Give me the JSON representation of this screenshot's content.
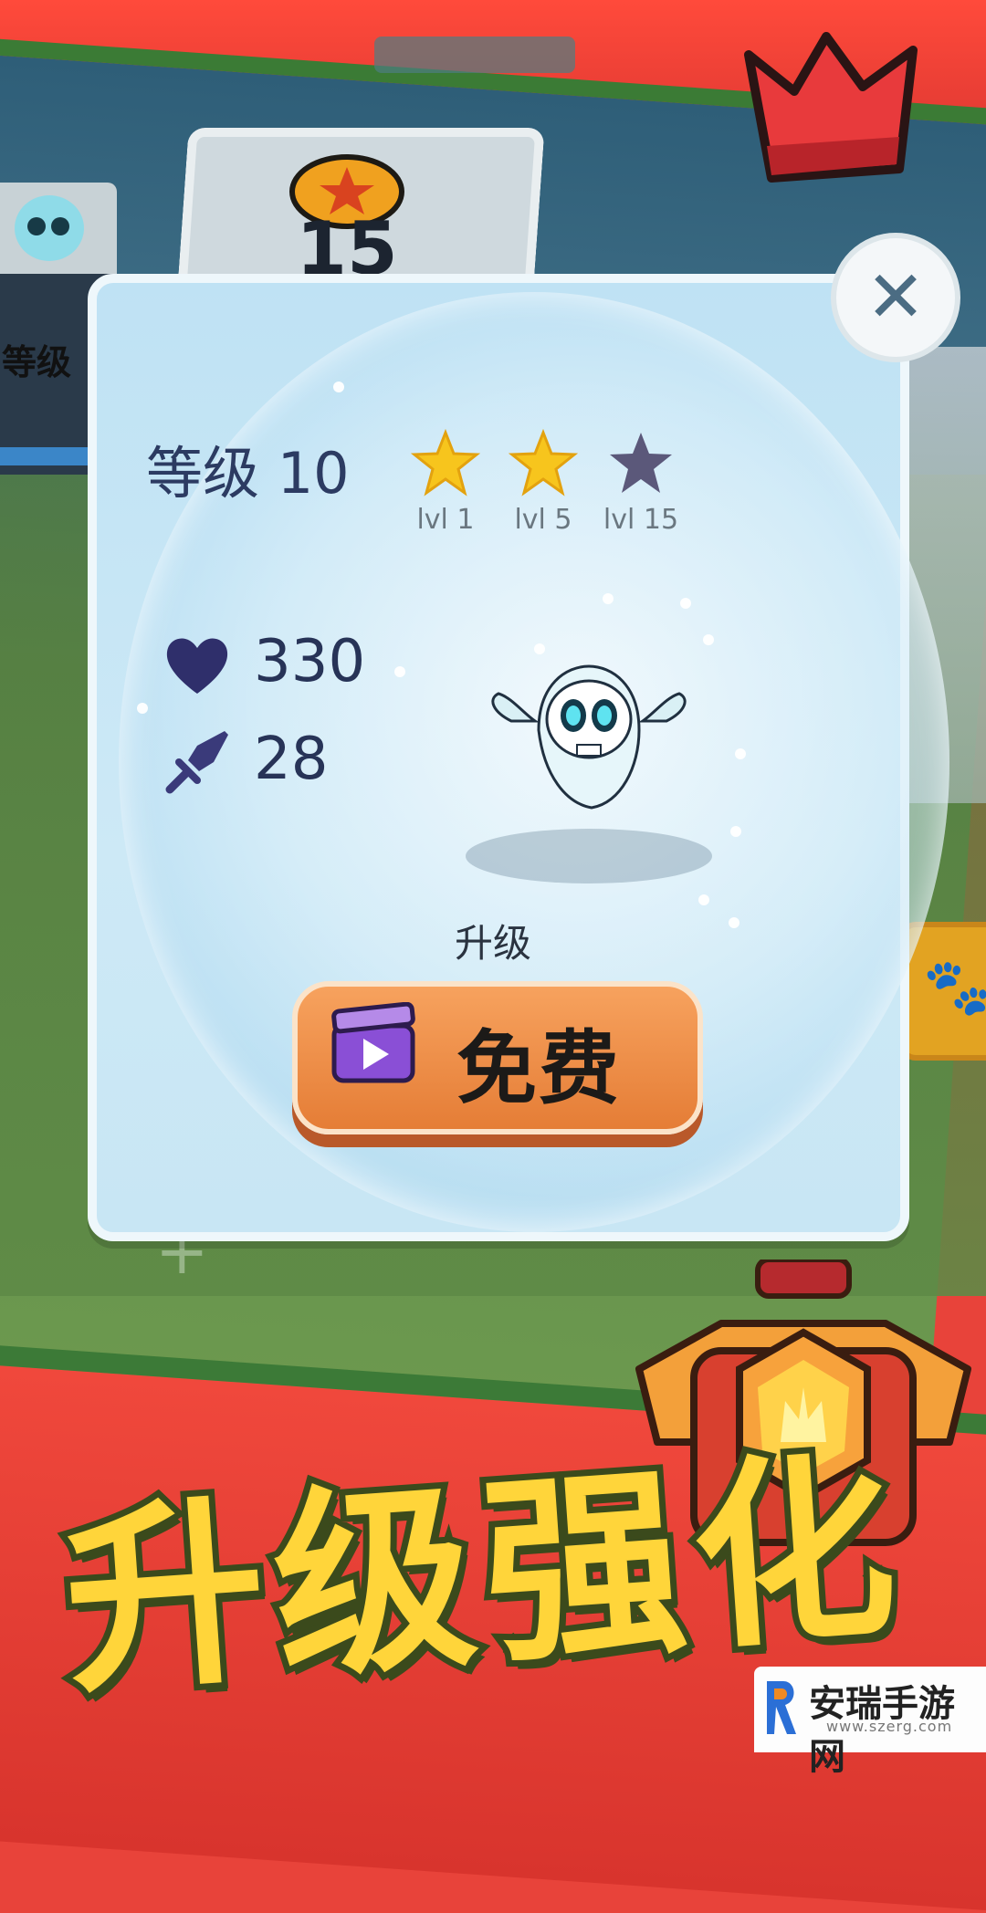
{
  "background": {
    "star_count": "15",
    "left_card_label": "等级",
    "paw_icon": "paw-icon"
  },
  "dialog": {
    "level_text": "等级 10",
    "stars": [
      {
        "label": "lvl 1",
        "filled": true
      },
      {
        "label": "lvl 5",
        "filled": true
      },
      {
        "label": "lvl 15",
        "filled": false
      }
    ],
    "stats": {
      "health_value": "330",
      "attack_value": "28"
    },
    "upgrade_label": "升级",
    "free_button_label": "免费",
    "colors": {
      "star_filled": "#f7c51d",
      "star_empty": "#5b587a",
      "button": "#e98543"
    }
  },
  "banner": {
    "title": "升级强化"
  },
  "watermark": {
    "name": "安瑞手游网",
    "url": "www.szerg.com"
  }
}
